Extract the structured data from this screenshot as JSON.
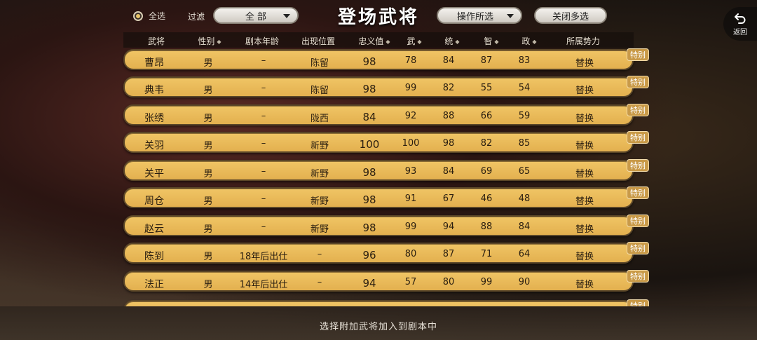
{
  "header": {
    "select_all_label": "全选",
    "filter_label": "过滤",
    "filter_value": "全 部",
    "title": "登场武将",
    "ops_label": "操作所选",
    "close_multi_label": "关闭多选",
    "back_label": "返回"
  },
  "columns": [
    "武将",
    "性别",
    "剧本年龄",
    "出现位置",
    "忠义值",
    "武",
    "统",
    "智",
    "政",
    "所属势力"
  ],
  "rows": [
    {
      "name": "曹昂",
      "gender": "男",
      "age": "–",
      "location": "陈留",
      "loyalty": "98",
      "wu": "78",
      "tong": "84",
      "zhi": "87",
      "zheng": "83",
      "faction": "替换",
      "tag": "特别"
    },
    {
      "name": "典韦",
      "gender": "男",
      "age": "–",
      "location": "陈留",
      "loyalty": "98",
      "wu": "99",
      "tong": "82",
      "zhi": "55",
      "zheng": "54",
      "faction": "替换",
      "tag": "特别"
    },
    {
      "name": "张绣",
      "gender": "男",
      "age": "–",
      "location": "陇西",
      "loyalty": "84",
      "wu": "92",
      "tong": "88",
      "zhi": "66",
      "zheng": "59",
      "faction": "替换",
      "tag": "特别"
    },
    {
      "name": "关羽",
      "gender": "男",
      "age": "–",
      "location": "新野",
      "loyalty": "100",
      "wu": "100",
      "tong": "98",
      "zhi": "82",
      "zheng": "85",
      "faction": "替换",
      "tag": "特别"
    },
    {
      "name": "关平",
      "gender": "男",
      "age": "–",
      "location": "新野",
      "loyalty": "98",
      "wu": "93",
      "tong": "84",
      "zhi": "69",
      "zheng": "65",
      "faction": "替换",
      "tag": "特别"
    },
    {
      "name": "周仓",
      "gender": "男",
      "age": "–",
      "location": "新野",
      "loyalty": "98",
      "wu": "91",
      "tong": "67",
      "zhi": "46",
      "zheng": "48",
      "faction": "替换",
      "tag": "特别"
    },
    {
      "name": "赵云",
      "gender": "男",
      "age": "–",
      "location": "新野",
      "loyalty": "98",
      "wu": "99",
      "tong": "94",
      "zhi": "88",
      "zheng": "84",
      "faction": "替换",
      "tag": "特别"
    },
    {
      "name": "陈到",
      "gender": "男",
      "age": "18年后出仕",
      "location": "–",
      "loyalty": "96",
      "wu": "80",
      "tong": "87",
      "zhi": "71",
      "zheng": "64",
      "faction": "替换",
      "tag": "特别"
    },
    {
      "name": "法正",
      "gender": "男",
      "age": "14年后出仕",
      "location": "–",
      "loyalty": "94",
      "wu": "57",
      "tong": "80",
      "zhi": "99",
      "zheng": "90",
      "faction": "替换",
      "tag": "特别"
    },
    {
      "name": "",
      "gender": "",
      "age": "",
      "location": "",
      "loyalty": "",
      "wu": "",
      "tong": "",
      "zhi": "",
      "zheng": "",
      "faction": "",
      "tag": "特别"
    }
  ],
  "footer": {
    "hint": "选择附加武将加入到剧本中"
  },
  "colors": {
    "row_gold": "#e8b85a",
    "row_border": "#5a4628",
    "special_tag": "#c99a48"
  },
  "icons": {
    "radio": "radio-selected-icon",
    "dropdown": "caret-down-icon",
    "back": "undo-arrow-icon",
    "sort": "sort-diamond-icon"
  }
}
